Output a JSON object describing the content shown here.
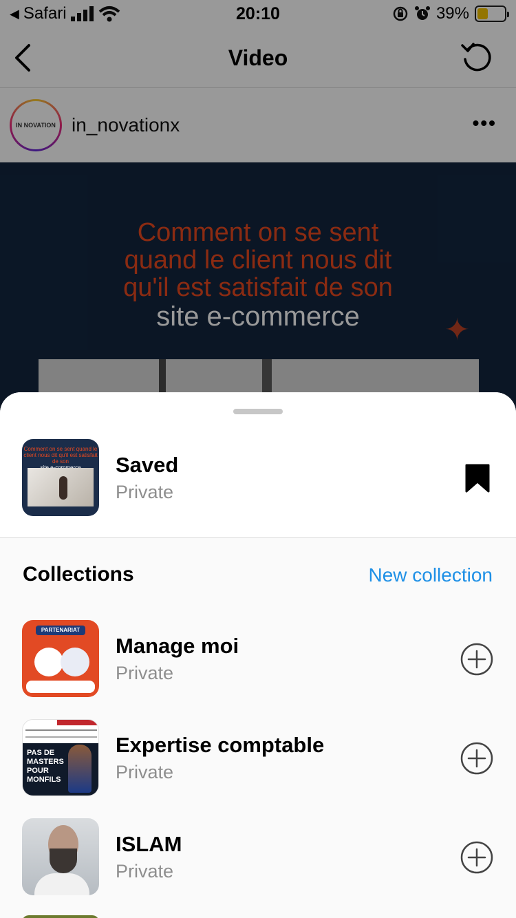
{
  "status_bar": {
    "back_app": "Safari",
    "time": "20:10",
    "battery_percent": "39%",
    "battery_level": 0.39
  },
  "nav": {
    "title": "Video"
  },
  "post": {
    "username": "in_novationx",
    "avatar_text": "IN NOVATION",
    "video_text_line1": "Comment on se sent",
    "video_text_line2": "quand le client  nous dit",
    "video_text_line3": "qu'il est satisfait de son",
    "video_text_line4": "site e-commerce"
  },
  "sheet": {
    "saved": {
      "title": "Saved",
      "subtitle": "Private",
      "thumb_text_top": "Comment on se sent quand le client  nous dit qu'il est satisfait de son",
      "thumb_text_bottom": "site e-commerce"
    },
    "collections_heading": "Collections",
    "new_collection_label": "New collection",
    "collections": [
      {
        "title": "Manage moi",
        "subtitle": "Private",
        "thumb_banner": "PARTENARIAT"
      },
      {
        "title": "Expertise comptable",
        "subtitle": "Private",
        "thumb_caption": "PAS DE MASTERS POUR MONFILS"
      },
      {
        "title": "ISLAM",
        "subtitle": "Private"
      }
    ]
  },
  "colors": {
    "accent_blue": "#1e90e6",
    "video_bg": "#13263f",
    "video_orange": "#e8491f"
  }
}
